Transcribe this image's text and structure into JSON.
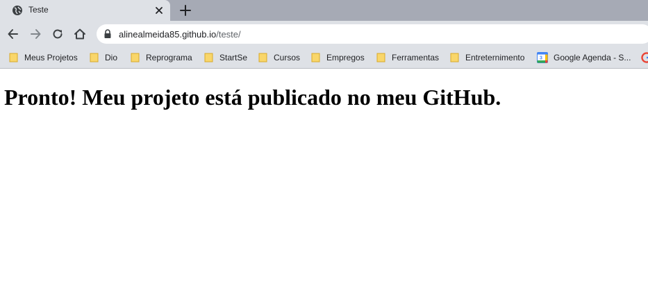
{
  "tab": {
    "title": "Teste",
    "favicon": "globe-icon",
    "close": "close-icon",
    "new_tab": "plus-icon"
  },
  "toolbar": {
    "back": "arrow-left-icon",
    "forward": "arrow-right-icon",
    "reload": "reload-icon",
    "home": "home-icon",
    "lock": "lock-icon",
    "url_host": "alinealmeida85.github.io",
    "url_path": "/teste/"
  },
  "bookmarks": [
    {
      "label": "Meus Projetos",
      "icon": "folder-icon"
    },
    {
      "label": "Dio",
      "icon": "folder-icon"
    },
    {
      "label": "Reprograma",
      "icon": "folder-icon"
    },
    {
      "label": "StartSe",
      "icon": "folder-icon"
    },
    {
      "label": "Cursos",
      "icon": "folder-icon"
    },
    {
      "label": "Empregos",
      "icon": "folder-icon"
    },
    {
      "label": "Ferramentas",
      "icon": "folder-icon"
    },
    {
      "label": "Entreternimento",
      "icon": "folder-icon"
    },
    {
      "label": "Google Agenda - S...",
      "icon": "google-calendar-icon"
    },
    {
      "label": "",
      "icon": "google-icon"
    }
  ],
  "page": {
    "heading": "Pronto! Meu projeto está publicado no meu GitHub."
  },
  "colors": {
    "tabstrip": "#a6aab5",
    "toolbar": "#dee1e6",
    "folder": "#f9d66a",
    "text": "#202124"
  }
}
